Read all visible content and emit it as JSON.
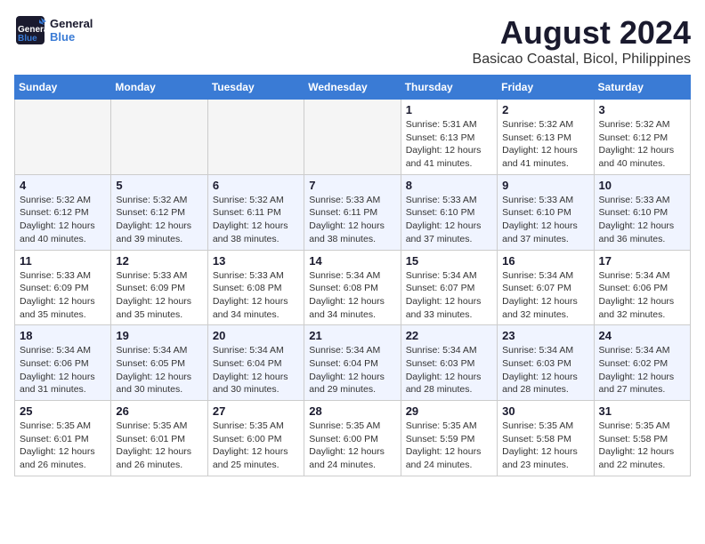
{
  "logo": {
    "general": "General",
    "blue": "Blue"
  },
  "header": {
    "month": "August 2024",
    "location": "Basicao Coastal, Bicol, Philippines"
  },
  "weekdays": [
    "Sunday",
    "Monday",
    "Tuesday",
    "Wednesday",
    "Thursday",
    "Friday",
    "Saturday"
  ],
  "weeks": [
    [
      {
        "day": "",
        "info": ""
      },
      {
        "day": "",
        "info": ""
      },
      {
        "day": "",
        "info": ""
      },
      {
        "day": "",
        "info": ""
      },
      {
        "day": "1",
        "sunrise": "Sunrise: 5:31 AM",
        "sunset": "Sunset: 6:13 PM",
        "daylight": "Daylight: 12 hours and 41 minutes."
      },
      {
        "day": "2",
        "sunrise": "Sunrise: 5:32 AM",
        "sunset": "Sunset: 6:13 PM",
        "daylight": "Daylight: 12 hours and 41 minutes."
      },
      {
        "day": "3",
        "sunrise": "Sunrise: 5:32 AM",
        "sunset": "Sunset: 6:12 PM",
        "daylight": "Daylight: 12 hours and 40 minutes."
      }
    ],
    [
      {
        "day": "4",
        "sunrise": "Sunrise: 5:32 AM",
        "sunset": "Sunset: 6:12 PM",
        "daylight": "Daylight: 12 hours and 40 minutes."
      },
      {
        "day": "5",
        "sunrise": "Sunrise: 5:32 AM",
        "sunset": "Sunset: 6:12 PM",
        "daylight": "Daylight: 12 hours and 39 minutes."
      },
      {
        "day": "6",
        "sunrise": "Sunrise: 5:32 AM",
        "sunset": "Sunset: 6:11 PM",
        "daylight": "Daylight: 12 hours and 38 minutes."
      },
      {
        "day": "7",
        "sunrise": "Sunrise: 5:33 AM",
        "sunset": "Sunset: 6:11 PM",
        "daylight": "Daylight: 12 hours and 38 minutes."
      },
      {
        "day": "8",
        "sunrise": "Sunrise: 5:33 AM",
        "sunset": "Sunset: 6:10 PM",
        "daylight": "Daylight: 12 hours and 37 minutes."
      },
      {
        "day": "9",
        "sunrise": "Sunrise: 5:33 AM",
        "sunset": "Sunset: 6:10 PM",
        "daylight": "Daylight: 12 hours and 37 minutes."
      },
      {
        "day": "10",
        "sunrise": "Sunrise: 5:33 AM",
        "sunset": "Sunset: 6:10 PM",
        "daylight": "Daylight: 12 hours and 36 minutes."
      }
    ],
    [
      {
        "day": "11",
        "sunrise": "Sunrise: 5:33 AM",
        "sunset": "Sunset: 6:09 PM",
        "daylight": "Daylight: 12 hours and 35 minutes."
      },
      {
        "day": "12",
        "sunrise": "Sunrise: 5:33 AM",
        "sunset": "Sunset: 6:09 PM",
        "daylight": "Daylight: 12 hours and 35 minutes."
      },
      {
        "day": "13",
        "sunrise": "Sunrise: 5:33 AM",
        "sunset": "Sunset: 6:08 PM",
        "daylight": "Daylight: 12 hours and 34 minutes."
      },
      {
        "day": "14",
        "sunrise": "Sunrise: 5:34 AM",
        "sunset": "Sunset: 6:08 PM",
        "daylight": "Daylight: 12 hours and 34 minutes."
      },
      {
        "day": "15",
        "sunrise": "Sunrise: 5:34 AM",
        "sunset": "Sunset: 6:07 PM",
        "daylight": "Daylight: 12 hours and 33 minutes."
      },
      {
        "day": "16",
        "sunrise": "Sunrise: 5:34 AM",
        "sunset": "Sunset: 6:07 PM",
        "daylight": "Daylight: 12 hours and 32 minutes."
      },
      {
        "day": "17",
        "sunrise": "Sunrise: 5:34 AM",
        "sunset": "Sunset: 6:06 PM",
        "daylight": "Daylight: 12 hours and 32 minutes."
      }
    ],
    [
      {
        "day": "18",
        "sunrise": "Sunrise: 5:34 AM",
        "sunset": "Sunset: 6:06 PM",
        "daylight": "Daylight: 12 hours and 31 minutes."
      },
      {
        "day": "19",
        "sunrise": "Sunrise: 5:34 AM",
        "sunset": "Sunset: 6:05 PM",
        "daylight": "Daylight: 12 hours and 30 minutes."
      },
      {
        "day": "20",
        "sunrise": "Sunrise: 5:34 AM",
        "sunset": "Sunset: 6:04 PM",
        "daylight": "Daylight: 12 hours and 30 minutes."
      },
      {
        "day": "21",
        "sunrise": "Sunrise: 5:34 AM",
        "sunset": "Sunset: 6:04 PM",
        "daylight": "Daylight: 12 hours and 29 minutes."
      },
      {
        "day": "22",
        "sunrise": "Sunrise: 5:34 AM",
        "sunset": "Sunset: 6:03 PM",
        "daylight": "Daylight: 12 hours and 28 minutes."
      },
      {
        "day": "23",
        "sunrise": "Sunrise: 5:34 AM",
        "sunset": "Sunset: 6:03 PM",
        "daylight": "Daylight: 12 hours and 28 minutes."
      },
      {
        "day": "24",
        "sunrise": "Sunrise: 5:34 AM",
        "sunset": "Sunset: 6:02 PM",
        "daylight": "Daylight: 12 hours and 27 minutes."
      }
    ],
    [
      {
        "day": "25",
        "sunrise": "Sunrise: 5:35 AM",
        "sunset": "Sunset: 6:01 PM",
        "daylight": "Daylight: 12 hours and 26 minutes."
      },
      {
        "day": "26",
        "sunrise": "Sunrise: 5:35 AM",
        "sunset": "Sunset: 6:01 PM",
        "daylight": "Daylight: 12 hours and 26 minutes."
      },
      {
        "day": "27",
        "sunrise": "Sunrise: 5:35 AM",
        "sunset": "Sunset: 6:00 PM",
        "daylight": "Daylight: 12 hours and 25 minutes."
      },
      {
        "day": "28",
        "sunrise": "Sunrise: 5:35 AM",
        "sunset": "Sunset: 6:00 PM",
        "daylight": "Daylight: 12 hours and 24 minutes."
      },
      {
        "day": "29",
        "sunrise": "Sunrise: 5:35 AM",
        "sunset": "Sunset: 5:59 PM",
        "daylight": "Daylight: 12 hours and 24 minutes."
      },
      {
        "day": "30",
        "sunrise": "Sunrise: 5:35 AM",
        "sunset": "Sunset: 5:58 PM",
        "daylight": "Daylight: 12 hours and 23 minutes."
      },
      {
        "day": "31",
        "sunrise": "Sunrise: 5:35 AM",
        "sunset": "Sunset: 5:58 PM",
        "daylight": "Daylight: 12 hours and 22 minutes."
      }
    ]
  ]
}
